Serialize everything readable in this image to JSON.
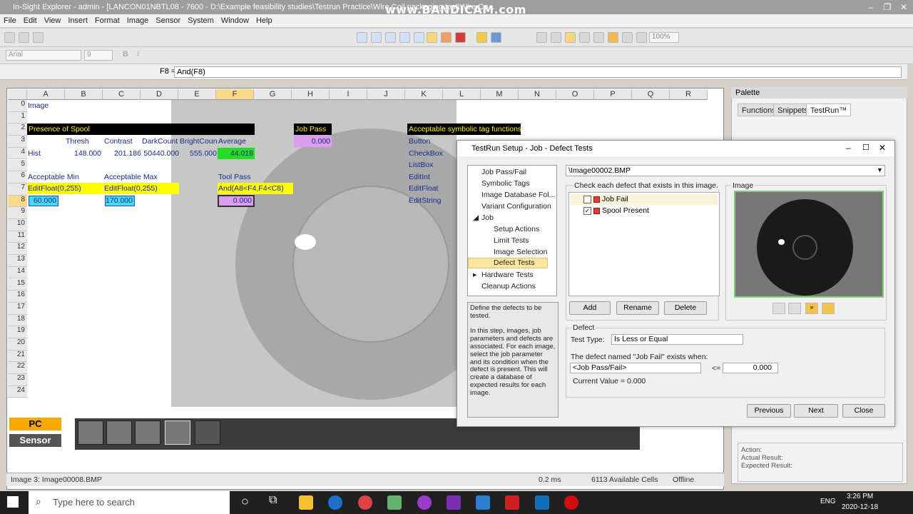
{
  "window": {
    "title": "In-Sight Explorer - admin - [LANCON01NBTL08 - 7600 - D:\\Example feasibility studies\\Testrun Practice\\Wire Coil packaging test\\Wire Co...",
    "watermark": "www.BANDICAM.com"
  },
  "menu": [
    "File",
    "Edit",
    "View",
    "Insert",
    "Format",
    "Image",
    "Sensor",
    "System",
    "Window",
    "Help"
  ],
  "font": {
    "name": "Arial",
    "size": "9",
    "zoom": "100%"
  },
  "formula": {
    "ref": "F8 =",
    "value": "And(F8)"
  },
  "sheet": {
    "columns": [
      "A",
      "B",
      "C",
      "D",
      "E",
      "F",
      "G",
      "H",
      "I",
      "J",
      "K",
      "L",
      "M",
      "N",
      "O",
      "P",
      "Q",
      "R"
    ],
    "rows": [
      "0",
      "1",
      "2",
      "3",
      "4",
      "5",
      "6",
      "7",
      "8",
      "9",
      "10",
      "11",
      "12",
      "13",
      "14",
      "15",
      "16",
      "17",
      "18",
      "19",
      "20",
      "21",
      "22",
      "23",
      "24"
    ],
    "cells": {
      "a0": "Image",
      "a2": "Presence of Spool",
      "b3": "Thresh",
      "c3": "Contrast",
      "d3": "DarkCount",
      "e3": "BrightCoun",
      "f3": "Average",
      "a4": "Hist",
      "b4": "148.000",
      "c4": "201.186",
      "d4": "50440.000",
      "e4": "555.000",
      "f4": "44.018",
      "a6": "Acceptable Min",
      "c6": "Acceptable Max",
      "f6": "Tool Pass",
      "a7": "EditFloat(0,255)",
      "c7": "EditFloat(0,255)",
      "f7": "And(A8<F4,F4<C8)",
      "a8": "60.000",
      "c8": "170.000",
      "f8": "0.000",
      "h2": "Job Pass",
      "h3": "0.000",
      "k2": "Acceptable symbolic tag functions",
      "k3": "Button",
      "k4": "CheckBox",
      "k5": "ListBox",
      "k6": "EditInt",
      "k7": "EditFloat",
      "k8": "EditString"
    }
  },
  "modes": {
    "pc": "PC",
    "sensor": "Sensor"
  },
  "status": {
    "image": "Image 3: Image00008.BMP",
    "time": "0.2 ms",
    "cells": "6113 Available Cells",
    "state": "Offline"
  },
  "palette": {
    "title": "Palette",
    "tabs": [
      "Functions",
      "Snippets",
      "TestRun™"
    ],
    "action": "Action:",
    "actual": "Actual Result:",
    "expected": "Expected Result:"
  },
  "dialog": {
    "title": "TestRun Setup - Job - Defect Tests",
    "tree": [
      "Job Pass/Fail",
      "Symbolic Tags",
      "Image Database Fol...",
      "Variant Configuration",
      "Job",
      "Setup Actions",
      "Limit Tests",
      "Image Selection",
      "Defect Tests",
      "Hardware Tests",
      "Cleanup Actions"
    ],
    "help": "Define the defects to be tested.\n\nIn this step, images, job parameters and defects are associated. For each image, select the job parameter and its condition when the defect is present. This will create a database of expected results for each image.",
    "image_path": "\\Image00002.BMP",
    "defect_caption": "Check each defect that exists in this image.",
    "defects": [
      {
        "name": "Job Fail",
        "checked": false
      },
      {
        "name": "Spool Present",
        "checked": true
      }
    ],
    "image_caption": "Image",
    "buttons": {
      "add": "Add",
      "rename": "Rename",
      "delete": "Delete",
      "previous": "Previous",
      "next": "Next",
      "close": "Close"
    },
    "defect_group": "Defect",
    "test_type_label": "Test Type:",
    "test_type": "Is Less or Equal",
    "exists_label": "The defect named \"Job Fail\" exists when:",
    "param": "<Job Pass/Fail>",
    "op": "<=",
    "value": "0.000",
    "current": "Current Value = 0.000"
  },
  "taskbar": {
    "search": "Type here to search",
    "time": "3:26 PM",
    "date": "2020-12-18",
    "lang": "ENG"
  }
}
